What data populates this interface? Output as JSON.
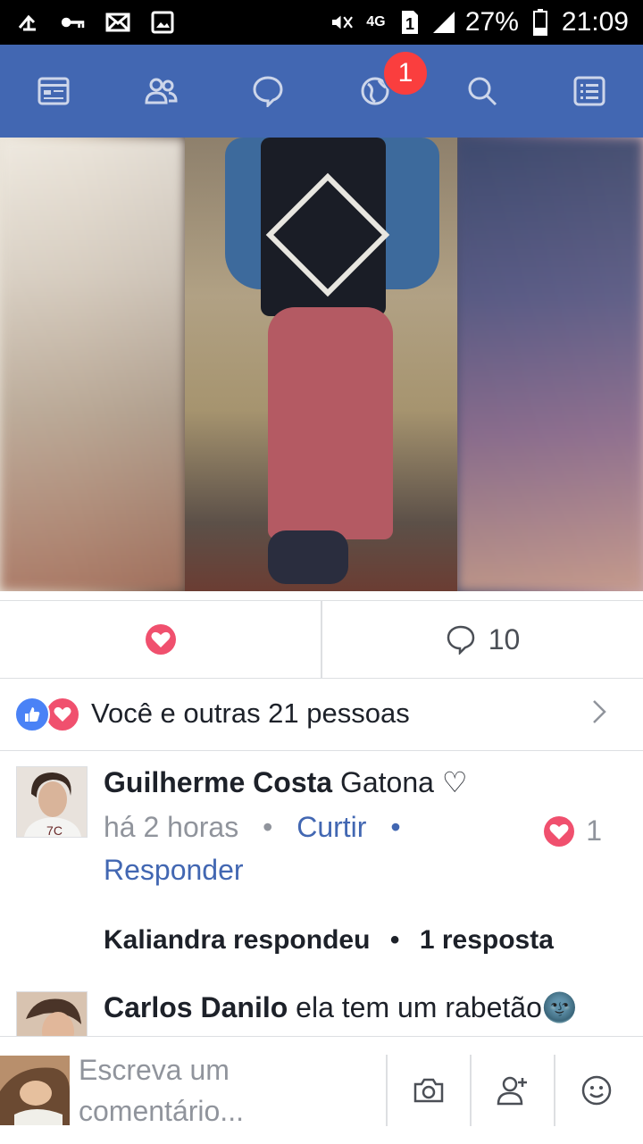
{
  "status_bar": {
    "left_icons": [
      "usb-icon",
      "key-icon",
      "mail-icon",
      "gallery-icon"
    ],
    "right_icons": [
      "mute-icon",
      "network-4g-icon",
      "sim-icon",
      "signal-icon"
    ],
    "battery": "27%",
    "time": "21:09"
  },
  "nav": {
    "items": [
      "news-feed-icon",
      "friends-icon",
      "messenger-icon",
      "notifications-globe-icon",
      "search-icon",
      "menu-icon"
    ],
    "notification_badge": "1",
    "color": "#4267b2"
  },
  "actions": {
    "comment_count": "10"
  },
  "reactions": {
    "text": "Você e outras 21 pessoas"
  },
  "comments": [
    {
      "author": "Guilherme Costa",
      "text": "Gatona ♡",
      "time": "há 2 horas",
      "like_label": "Curtir",
      "separator": "•",
      "reply_label": "Responder",
      "reaction_count": "1",
      "reply_summary_author": "Kaliandra respondeu",
      "reply_summary_sep": "•",
      "reply_summary_count": "1 resposta"
    },
    {
      "author": "Carlos Danilo",
      "text": "ela tem um rabetão🌚"
    }
  ],
  "composer": {
    "placeholder_line1": "Escreva um",
    "placeholder_line2": "comentário..."
  }
}
